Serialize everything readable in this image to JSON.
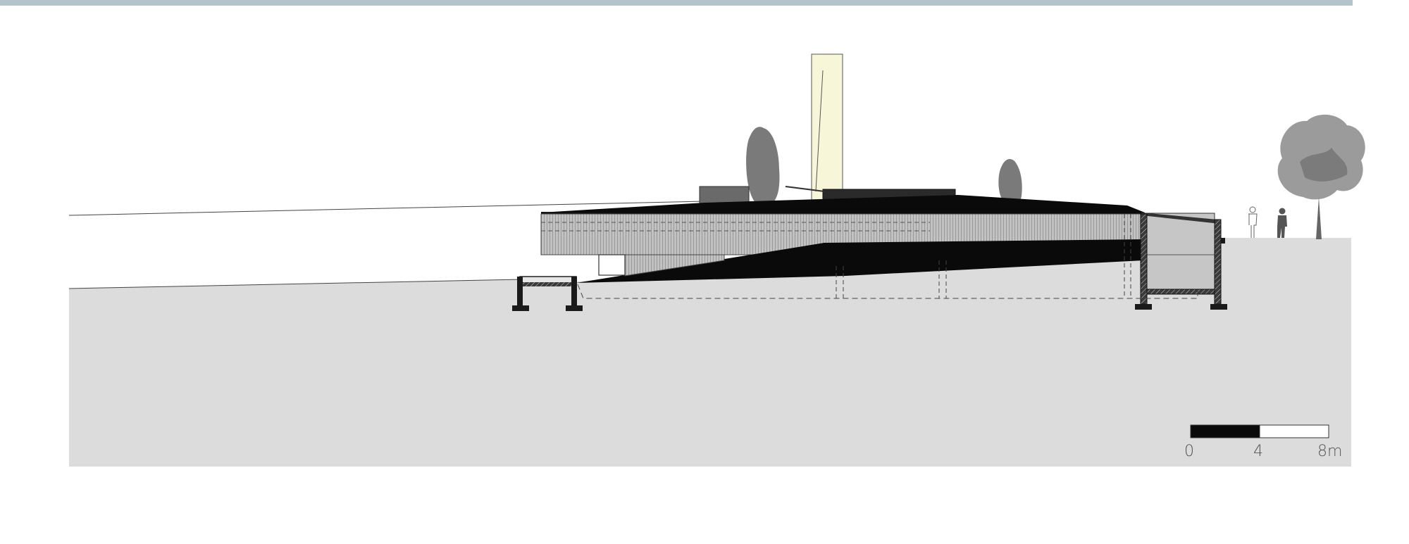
{
  "colors": {
    "top_band": "#b4c4cc",
    "ground": "#dcdcdc",
    "building_black": "#0a0a0a",
    "cladding_gray": "#b8b8b8",
    "tower_yellow": "#f8f6d8",
    "vegetation": "#7a7a7a"
  },
  "scale_bar": {
    "label_start": "0",
    "label_mid": "4",
    "label_end": "8m"
  }
}
